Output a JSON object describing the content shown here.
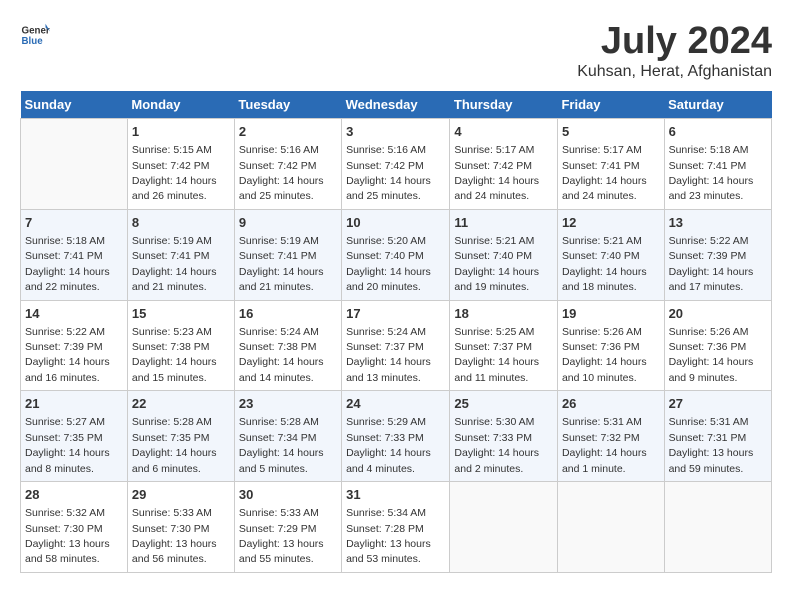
{
  "header": {
    "logo_general": "General",
    "logo_blue": "Blue",
    "month_year": "July 2024",
    "location": "Kuhsan, Herat, Afghanistan"
  },
  "weekdays": [
    "Sunday",
    "Monday",
    "Tuesday",
    "Wednesday",
    "Thursday",
    "Friday",
    "Saturday"
  ],
  "weeks": [
    [
      {
        "day": "",
        "info": ""
      },
      {
        "day": "1",
        "info": "Sunrise: 5:15 AM\nSunset: 7:42 PM\nDaylight: 14 hours\nand 26 minutes."
      },
      {
        "day": "2",
        "info": "Sunrise: 5:16 AM\nSunset: 7:42 PM\nDaylight: 14 hours\nand 25 minutes."
      },
      {
        "day": "3",
        "info": "Sunrise: 5:16 AM\nSunset: 7:42 PM\nDaylight: 14 hours\nand 25 minutes."
      },
      {
        "day": "4",
        "info": "Sunrise: 5:17 AM\nSunset: 7:42 PM\nDaylight: 14 hours\nand 24 minutes."
      },
      {
        "day": "5",
        "info": "Sunrise: 5:17 AM\nSunset: 7:41 PM\nDaylight: 14 hours\nand 24 minutes."
      },
      {
        "day": "6",
        "info": "Sunrise: 5:18 AM\nSunset: 7:41 PM\nDaylight: 14 hours\nand 23 minutes."
      }
    ],
    [
      {
        "day": "7",
        "info": "Sunrise: 5:18 AM\nSunset: 7:41 PM\nDaylight: 14 hours\nand 22 minutes."
      },
      {
        "day": "8",
        "info": "Sunrise: 5:19 AM\nSunset: 7:41 PM\nDaylight: 14 hours\nand 21 minutes."
      },
      {
        "day": "9",
        "info": "Sunrise: 5:19 AM\nSunset: 7:41 PM\nDaylight: 14 hours\nand 21 minutes."
      },
      {
        "day": "10",
        "info": "Sunrise: 5:20 AM\nSunset: 7:40 PM\nDaylight: 14 hours\nand 20 minutes."
      },
      {
        "day": "11",
        "info": "Sunrise: 5:21 AM\nSunset: 7:40 PM\nDaylight: 14 hours\nand 19 minutes."
      },
      {
        "day": "12",
        "info": "Sunrise: 5:21 AM\nSunset: 7:40 PM\nDaylight: 14 hours\nand 18 minutes."
      },
      {
        "day": "13",
        "info": "Sunrise: 5:22 AM\nSunset: 7:39 PM\nDaylight: 14 hours\nand 17 minutes."
      }
    ],
    [
      {
        "day": "14",
        "info": "Sunrise: 5:22 AM\nSunset: 7:39 PM\nDaylight: 14 hours\nand 16 minutes."
      },
      {
        "day": "15",
        "info": "Sunrise: 5:23 AM\nSunset: 7:38 PM\nDaylight: 14 hours\nand 15 minutes."
      },
      {
        "day": "16",
        "info": "Sunrise: 5:24 AM\nSunset: 7:38 PM\nDaylight: 14 hours\nand 14 minutes."
      },
      {
        "day": "17",
        "info": "Sunrise: 5:24 AM\nSunset: 7:37 PM\nDaylight: 14 hours\nand 13 minutes."
      },
      {
        "day": "18",
        "info": "Sunrise: 5:25 AM\nSunset: 7:37 PM\nDaylight: 14 hours\nand 11 minutes."
      },
      {
        "day": "19",
        "info": "Sunrise: 5:26 AM\nSunset: 7:36 PM\nDaylight: 14 hours\nand 10 minutes."
      },
      {
        "day": "20",
        "info": "Sunrise: 5:26 AM\nSunset: 7:36 PM\nDaylight: 14 hours\nand 9 minutes."
      }
    ],
    [
      {
        "day": "21",
        "info": "Sunrise: 5:27 AM\nSunset: 7:35 PM\nDaylight: 14 hours\nand 8 minutes."
      },
      {
        "day": "22",
        "info": "Sunrise: 5:28 AM\nSunset: 7:35 PM\nDaylight: 14 hours\nand 6 minutes."
      },
      {
        "day": "23",
        "info": "Sunrise: 5:28 AM\nSunset: 7:34 PM\nDaylight: 14 hours\nand 5 minutes."
      },
      {
        "day": "24",
        "info": "Sunrise: 5:29 AM\nSunset: 7:33 PM\nDaylight: 14 hours\nand 4 minutes."
      },
      {
        "day": "25",
        "info": "Sunrise: 5:30 AM\nSunset: 7:33 PM\nDaylight: 14 hours\nand 2 minutes."
      },
      {
        "day": "26",
        "info": "Sunrise: 5:31 AM\nSunset: 7:32 PM\nDaylight: 14 hours\nand 1 minute."
      },
      {
        "day": "27",
        "info": "Sunrise: 5:31 AM\nSunset: 7:31 PM\nDaylight: 13 hours\nand 59 minutes."
      }
    ],
    [
      {
        "day": "28",
        "info": "Sunrise: 5:32 AM\nSunset: 7:30 PM\nDaylight: 13 hours\nand 58 minutes."
      },
      {
        "day": "29",
        "info": "Sunrise: 5:33 AM\nSunset: 7:30 PM\nDaylight: 13 hours\nand 56 minutes."
      },
      {
        "day": "30",
        "info": "Sunrise: 5:33 AM\nSunset: 7:29 PM\nDaylight: 13 hours\nand 55 minutes."
      },
      {
        "day": "31",
        "info": "Sunrise: 5:34 AM\nSunset: 7:28 PM\nDaylight: 13 hours\nand 53 minutes."
      },
      {
        "day": "",
        "info": ""
      },
      {
        "day": "",
        "info": ""
      },
      {
        "day": "",
        "info": ""
      }
    ]
  ]
}
